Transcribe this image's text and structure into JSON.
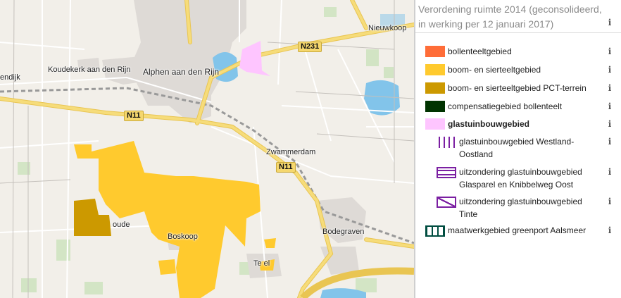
{
  "map": {
    "places": [
      {
        "key": "nieuwkoop",
        "label": "Nieuwkoop"
      },
      {
        "key": "koudekerk",
        "label": "Koudekerk aan den Rijn"
      },
      {
        "key": "alphen",
        "label": "Alphen aan den Rijn"
      },
      {
        "key": "zwammerdam",
        "label": "Zwammerdam"
      },
      {
        "key": "boskoop",
        "label": "Boskoop"
      },
      {
        "key": "bodegraven",
        "label": "Bodegraven"
      },
      {
        "key": "endijk",
        "label": "endijk"
      },
      {
        "key": "oude",
        "label": "oude"
      },
      {
        "key": "tempel",
        "label": "Te     el"
      }
    ],
    "roads": {
      "n231": "N231",
      "n11a": "N11",
      "n11b": "N11"
    },
    "colors": {
      "bollenteelt": "#ff6d38",
      "boom_sierteelt": "#ffca2e",
      "pct": "#cc9900",
      "compensatie": "#003300",
      "glastuinbouw": "#fec5ff",
      "glas_purple": "#7b1fa2",
      "maatwerk": "#004d40",
      "water": "#82c4ea",
      "road_yellow": "#f6dc7a"
    }
  },
  "panel": {
    "title": "Verordening ruimte 2014 (geconsolideerd, in werking per 12 januari 2017)",
    "info_symbol": "i",
    "legend": [
      {
        "label": "bollenteeltgebied",
        "swatch": "solid",
        "color": "#ff6d38",
        "bold": false,
        "sub": false
      },
      {
        "label": "boom- en sierteeltgebied",
        "swatch": "solid",
        "color": "#ffca2e",
        "bold": false,
        "sub": false
      },
      {
        "label": "boom- en sierteeltgebied PCT-terrein",
        "swatch": "solid",
        "color": "#cc9900",
        "bold": false,
        "sub": false
      },
      {
        "label": "compensatiegebied bollenteelt",
        "swatch": "solid",
        "color": "#003300",
        "bold": false,
        "sub": false
      },
      {
        "label": "glastuinbouwgebied",
        "swatch": "solid",
        "color": "#fec5ff",
        "bold": true,
        "sub": false
      },
      {
        "label": "glastuinbouwgebied Westland-Oostland",
        "swatch": "vlines",
        "color": "#7b1fa2",
        "bold": false,
        "sub": true
      },
      {
        "label": "uitzondering glastuinbouwgebied Glasparel en Knibbelweg Oost",
        "swatch": "hlines",
        "color": "#7b1fa2",
        "bold": false,
        "sub": true
      },
      {
        "label": "uitzondering glastuinbouwgebied Tinte",
        "swatch": "diag",
        "color": "#7b1fa2",
        "bold": false,
        "sub": true
      },
      {
        "label": "maatwerkgebied greenport Aalsmeer",
        "swatch": "vbox",
        "color": "#004d40",
        "bold": false,
        "sub": false
      }
    ]
  }
}
